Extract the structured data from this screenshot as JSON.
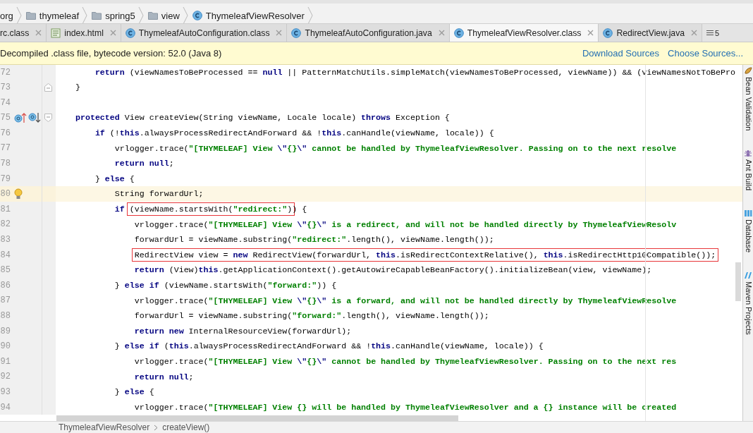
{
  "breadcrumbs": [
    {
      "label": "org"
    },
    {
      "label": "thymeleaf",
      "kind": "package"
    },
    {
      "label": "spring5",
      "kind": "package"
    },
    {
      "label": "view",
      "kind": "package"
    },
    {
      "label": "ThymeleafViewResolver",
      "kind": "class"
    }
  ],
  "tabs": [
    {
      "label": "rc.class",
      "selected": false
    },
    {
      "label": "index.html",
      "kind": "html",
      "selected": false
    },
    {
      "label": "ThymeleafAutoConfiguration.class",
      "kind": "class",
      "selected": false
    },
    {
      "label": "ThymeleafAutoConfiguration.java",
      "kind": "class",
      "selected": false
    },
    {
      "label": "ThymeleafViewResolver.class",
      "kind": "class",
      "selected": true
    },
    {
      "label": "RedirectView.java",
      "kind": "class",
      "selected": false
    }
  ],
  "tabs_overflow": {
    "count": "5"
  },
  "banner": {
    "message": "Decompiled .class file, bytecode version: 52.0 (Java 8)",
    "links": [
      "Download Sources",
      "Choose Sources..."
    ]
  },
  "editor": {
    "lines": [
      {
        "number": "72",
        "current": false,
        "tokens": [
          {
            "kind": "keyword",
            "text": "        return"
          },
          {
            "kind": "plain",
            "text": " (viewNamesToBeProcessed == "
          },
          {
            "kind": "keyword",
            "text": "null"
          },
          {
            "kind": "plain",
            "text": " || PatternMatchUtils.simpleMatch(viewNamesToBeProcessed, viewName)) && (viewNamesNotToBePro"
          }
        ]
      },
      {
        "number": "73",
        "current": false,
        "kind": "block_end",
        "tokens": [
          {
            "kind": "plain",
            "text": "    }"
          }
        ]
      },
      {
        "number": "74",
        "current": false
      },
      {
        "number": "75",
        "current": false,
        "kind": "method_start",
        "tokens": [
          {
            "kind": "keyword",
            "text": "    protected"
          },
          {
            "kind": "plain",
            "text": " View createView(String viewName, Locale locale) "
          },
          {
            "kind": "keyword",
            "text": "throws"
          },
          {
            "kind": "plain",
            "text": " Exception {"
          }
        ]
      },
      {
        "number": "76",
        "current": false,
        "tokens": [
          {
            "kind": "keyword",
            "text": "        if"
          },
          {
            "kind": "plain",
            "text": " (!"
          },
          {
            "kind": "keyword",
            "text": "this"
          },
          {
            "kind": "plain",
            "text": ".alwaysProcessRedirectAndForward && !"
          },
          {
            "kind": "keyword",
            "text": "this"
          },
          {
            "kind": "plain",
            "text": ".canHandle(viewName, locale)) {"
          }
        ]
      },
      {
        "number": "77",
        "current": false,
        "tokens": [
          {
            "kind": "plain",
            "text": "            vrlogger.trace("
          },
          {
            "kind": "string",
            "text": "\"[THYMELEAF] View "
          },
          {
            "kind": "escape",
            "text": "\\\""
          },
          {
            "kind": "string",
            "text": "{}"
          },
          {
            "kind": "escape",
            "text": "\\\""
          },
          {
            "kind": "string",
            "text": " cannot be handled by ThymeleafViewResolver. Passing on to the next resolve"
          }
        ]
      },
      {
        "number": "78",
        "current": false,
        "tokens": [
          {
            "kind": "keyword",
            "text": "            return null"
          },
          {
            "kind": "plain",
            "text": ";"
          }
        ]
      },
      {
        "number": "79",
        "current": false,
        "tokens": [
          {
            "kind": "plain",
            "text": "        } "
          },
          {
            "kind": "keyword",
            "text": "else"
          },
          {
            "kind": "plain",
            "text": " {"
          }
        ]
      },
      {
        "number": "80",
        "current": true,
        "kind": "intention",
        "tokens": [
          {
            "kind": "plain",
            "text": "            String forwardUrl;"
          }
        ]
      },
      {
        "number": "81",
        "current": false,
        "tokens": [
          {
            "kind": "keyword",
            "text": "            if "
          },
          {
            "kind": "boxed",
            "tokens": [
              {
                "kind": "plain",
                "text": "(viewName.startsWith("
              },
              {
                "kind": "string",
                "text": "\"redirect:\""
              },
              {
                "kind": "plain",
                "text": ")"
              }
            ]
          },
          {
            "kind": "plain",
            "text": ") {"
          }
        ]
      },
      {
        "number": "82",
        "current": false,
        "tokens": [
          {
            "kind": "plain",
            "text": "                vrlogger.trace("
          },
          {
            "kind": "string",
            "text": "\"[THYMELEAF] View "
          },
          {
            "kind": "escape",
            "text": "\\\""
          },
          {
            "kind": "string",
            "text": "{}"
          },
          {
            "kind": "escape",
            "text": "\\\""
          },
          {
            "kind": "string",
            "text": " is a redirect, and will not be handled directly by ThymeleafViewResolv"
          }
        ]
      },
      {
        "number": "83",
        "current": false,
        "tokens": [
          {
            "kind": "plain",
            "text": "                forwardUrl = viewName.substring("
          },
          {
            "kind": "string",
            "text": "\"redirect:\""
          },
          {
            "kind": "plain",
            "text": ".length(), viewName.length());"
          }
        ]
      },
      {
        "number": "84",
        "current": false,
        "tokens": [
          {
            "kind": "boxed",
            "tokens": [
              {
                "kind": "plain",
                "text": "                RedirectView view = "
              },
              {
                "kind": "keyword",
                "text": "new"
              },
              {
                "kind": "plain",
                "text": " RedirectView(forwardUrl, "
              },
              {
                "kind": "keyword",
                "text": "this"
              },
              {
                "kind": "plain",
                "text": ".isRedirectContextRelative(), "
              },
              {
                "kind": "keyword",
                "text": "this"
              },
              {
                "kind": "plain",
                "text": ".isRedirectHttp10Compatible());"
              }
            ]
          }
        ]
      },
      {
        "number": "85",
        "current": false,
        "tokens": [
          {
            "kind": "keyword",
            "text": "                return"
          },
          {
            "kind": "plain",
            "text": " (View)"
          },
          {
            "kind": "keyword",
            "text": "this"
          },
          {
            "kind": "plain",
            "text": ".getApplicationContext().getAutowireCapableBeanFactory().initializeBean(view, viewName);"
          }
        ]
      },
      {
        "number": "86",
        "current": false,
        "tokens": [
          {
            "kind": "plain",
            "text": "            } "
          },
          {
            "kind": "keyword",
            "text": "else if"
          },
          {
            "kind": "plain",
            "text": " (viewName.startsWith("
          },
          {
            "kind": "string",
            "text": "\"forward:\""
          },
          {
            "kind": "plain",
            "text": ")) {"
          }
        ]
      },
      {
        "number": "87",
        "current": false,
        "tokens": [
          {
            "kind": "plain",
            "text": "                vrlogger.trace("
          },
          {
            "kind": "string",
            "text": "\"[THYMELEAF] View "
          },
          {
            "kind": "escape",
            "text": "\\\""
          },
          {
            "kind": "string",
            "text": "{}"
          },
          {
            "kind": "escape",
            "text": "\\\""
          },
          {
            "kind": "string",
            "text": " is a forward, and will not be handled directly by ThymeleafViewResolve"
          }
        ]
      },
      {
        "number": "88",
        "current": false,
        "tokens": [
          {
            "kind": "plain",
            "text": "                forwardUrl = viewName.substring("
          },
          {
            "kind": "string",
            "text": "\"forward:\""
          },
          {
            "kind": "plain",
            "text": ".length(), viewName.length());"
          }
        ]
      },
      {
        "number": "89",
        "current": false,
        "tokens": [
          {
            "kind": "keyword",
            "text": "                return new"
          },
          {
            "kind": "plain",
            "text": " InternalResourceView(forwardUrl);"
          }
        ]
      },
      {
        "number": "90",
        "current": false,
        "tokens": [
          {
            "kind": "plain",
            "text": "            } "
          },
          {
            "kind": "keyword",
            "text": "else if"
          },
          {
            "kind": "plain",
            "text": " ("
          },
          {
            "kind": "keyword",
            "text": "this"
          },
          {
            "kind": "plain",
            "text": ".alwaysProcessRedirectAndForward && !"
          },
          {
            "kind": "keyword",
            "text": "this"
          },
          {
            "kind": "plain",
            "text": ".canHandle(viewName, locale)) {"
          }
        ]
      },
      {
        "number": "91",
        "current": false,
        "tokens": [
          {
            "kind": "plain",
            "text": "                vrlogger.trace("
          },
          {
            "kind": "string",
            "text": "\"[THYMELEAF] View "
          },
          {
            "kind": "escape",
            "text": "\\\""
          },
          {
            "kind": "string",
            "text": "{}"
          },
          {
            "kind": "escape",
            "text": "\\\""
          },
          {
            "kind": "string",
            "text": " cannot be handled by ThymeleafViewResolver. Passing on to the next res"
          }
        ]
      },
      {
        "number": "92",
        "current": false,
        "tokens": [
          {
            "kind": "keyword",
            "text": "                return null"
          },
          {
            "kind": "plain",
            "text": ";"
          }
        ]
      },
      {
        "number": "93",
        "current": false,
        "tokens": [
          {
            "kind": "plain",
            "text": "            } "
          },
          {
            "kind": "keyword",
            "text": "else"
          },
          {
            "kind": "plain",
            "text": " {"
          }
        ]
      },
      {
        "number": "94",
        "current": false,
        "tokens": [
          {
            "kind": "plain",
            "text": "                vrlogger.trace("
          },
          {
            "kind": "string",
            "text": "\"[THYMELEAF] View {} will be handled by ThymeleafViewResolver and a {} instance will be created"
          }
        ]
      }
    ]
  },
  "tool_windows": [
    {
      "label": "Bean Validation",
      "kind": "bean"
    },
    {
      "label": "Ant Build",
      "kind": "ant"
    },
    {
      "label": "Database",
      "kind": "database"
    },
    {
      "label": "Maven Projects",
      "kind": "maven"
    }
  ],
  "status_bar": {
    "breadcrumbs": [
      "ThymeleafViewResolver",
      "createView()"
    ]
  }
}
